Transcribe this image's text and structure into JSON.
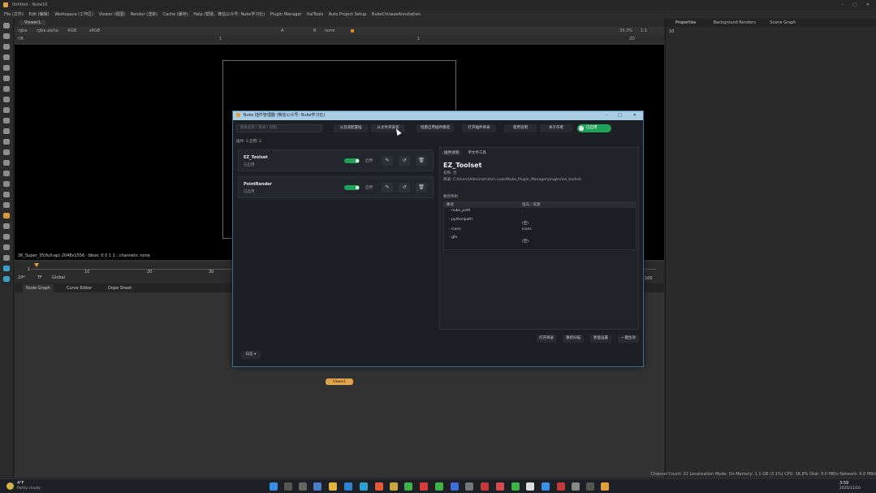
{
  "window": {
    "title": "Untitled - Nuke16"
  },
  "menubar": [
    "File (文件)",
    "Edit (编辑)",
    "Workspace (工作区)",
    "Viewer (视图)",
    "Render (渲染)",
    "Cache (缓存)",
    "Help (帮助，微信公众号: Nuke学习社)",
    "Plugin Manager",
    "KaiTools",
    "Auto Project Setup",
    "NukeChineseAnnotation"
  ],
  "viewer": {
    "tab": "Viewer1",
    "channel": "rgba",
    "layer": "rgba.alpha",
    "colorspace_in": "RGB",
    "colorspace_out": "sRGB",
    "zoom": "33.3%",
    "ratio": "1:1",
    "mode": "2D",
    "gain_label": "f/8",
    "frame_field": "1",
    "gamma": "1",
    "a_input": "A",
    "b_input": "B",
    "none_label": "none",
    "status": "2K_Super_35(full-ap) 2048x1556 · bbox: 0 0 1 1 : channels: none"
  },
  "timeline": {
    "fps": "24*",
    "tf": "TF",
    "scope": "Global",
    "ticks": [
      "1",
      "10",
      "20",
      "30"
    ],
    "end": "100",
    "start_frame": "1"
  },
  "bottom_tabs": [
    "Node Graph",
    "Curve Editor",
    "Dope Sheet"
  ],
  "right_tabs": [
    "Properties",
    "Background Renders",
    "Scene Graph"
  ],
  "right_count": "10",
  "status_bar": "Channel Count: 22  Localization Mode: On  Memory: 1.1 GB (3.1%)  CPU: 16.8%  Disk: 0.0 MB/s  Network: 0.0 MB/s",
  "node_label": "Viewer1",
  "dialog": {
    "title": "Nuke 插件管理器 (微信公众号: Nuke学习社)",
    "search_placeholder": "搜索名称 / 目录 / 说明...",
    "toolbar": [
      "从温道配置插",
      "从文件夹安装",
      "批量启用插件路径",
      "打开插件目录",
      "使用说明",
      "关于作者",
      "批量禁"
    ],
    "toggle_all": "已启用",
    "counts": "插件: 2    启用: 2",
    "plugins": [
      {
        "name": "EZ_Toolset",
        "status": "已启用",
        "switch_label": "启用"
      },
      {
        "name": "PointRender",
        "status": "已启用",
        "switch_label": "启用"
      }
    ],
    "detail": {
      "tabs": [
        "插件详情",
        "单文件工具"
      ],
      "title": "EZ_Toolset",
      "name_line": "名称: 否",
      "dir_line": "目录: C:\\Users\\Administrator\\.nuke\\Nuke_Plugin_Manager\\plugins\\ez_toolset",
      "section": "路径映射",
      "cols": [
        "路径",
        "指向 / 资源"
      ],
      "rows": [
        {
          "key": "nuke_path",
          "val": "."
        },
        {
          "key": "pythonpath",
          "val": "(空)"
        },
        {
          "key": "icons",
          "val": "icons"
        },
        {
          "key": "gfx",
          "val": "(空)"
        }
      ]
    },
    "bottom_buttons": [
      "打开目录",
      "重新扫描",
      "智能设置",
      "一键生效"
    ],
    "log_button": "日志 ▾"
  },
  "taskbar": {
    "weather_temp": "4°F",
    "weather_text": "Partly cloudy",
    "time": "3:59",
    "date": "2025/11/10"
  }
}
